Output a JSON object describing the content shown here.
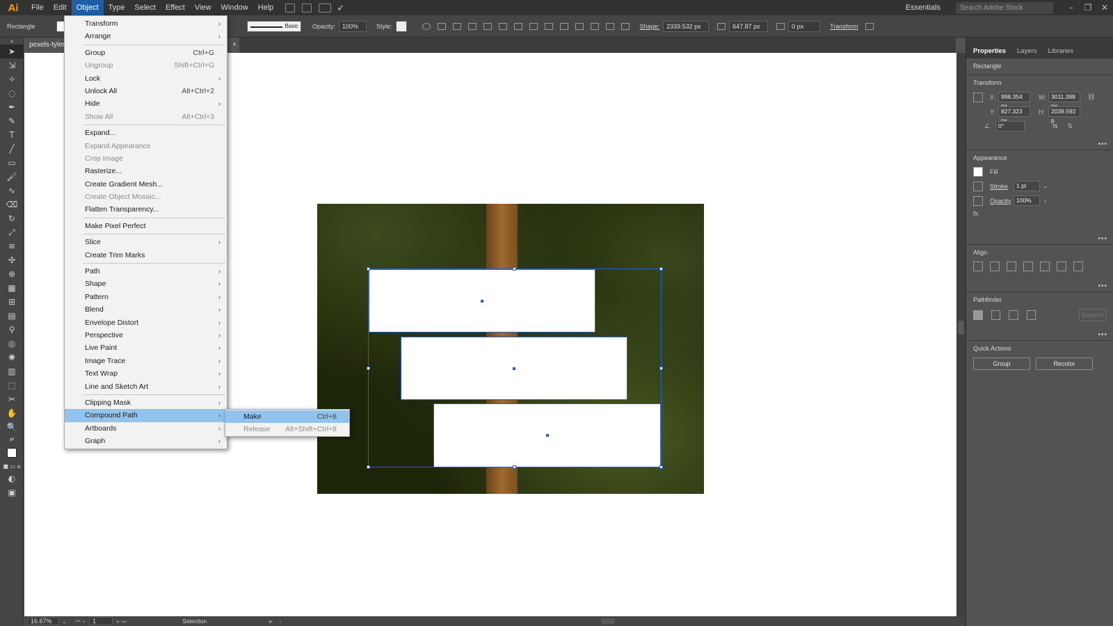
{
  "app": {
    "logo": "Ai"
  },
  "menubar": {
    "items": [
      "File",
      "Edit",
      "Object",
      "Type",
      "Select",
      "Effect",
      "View",
      "Window",
      "Help"
    ],
    "active": "Object",
    "workspace": "Essentials",
    "search_placeholder": "Search Adobe Stock"
  },
  "controlbar": {
    "object_type": "Rectangle",
    "stroke_style": "Basic",
    "opacity_label": "Opacity:",
    "opacity_value": "100%",
    "style_label": "Style:",
    "shape_label": "Shape:",
    "shape_width": "2339.532 px",
    "shape_height": "647.87 px",
    "corner_radius": "0 px",
    "transform_label": "Transform"
  },
  "document": {
    "tab_title": "pexels-tyler",
    "close": "×"
  },
  "object_menu": {
    "rows": [
      {
        "label": "Transform",
        "arrow": true
      },
      {
        "label": "Arrange",
        "arrow": true
      },
      {
        "sep": true
      },
      {
        "label": "Group",
        "shortcut": "Ctrl+G"
      },
      {
        "label": "Ungroup",
        "shortcut": "Shift+Ctrl+G",
        "disabled": true
      },
      {
        "label": "Lock",
        "arrow": true
      },
      {
        "label": "Unlock All",
        "shortcut": "Alt+Ctrl+2"
      },
      {
        "label": "Hide",
        "arrow": true
      },
      {
        "label": "Show All",
        "shortcut": "Alt+Ctrl+3",
        "disabled": true
      },
      {
        "sep": true
      },
      {
        "label": "Expand..."
      },
      {
        "label": "Expand Appearance",
        "disabled": true
      },
      {
        "label": "Crop Image",
        "disabled": true
      },
      {
        "label": "Rasterize..."
      },
      {
        "label": "Create Gradient Mesh..."
      },
      {
        "label": "Create Object Mosaic...",
        "disabled": true
      },
      {
        "label": "Flatten Transparency..."
      },
      {
        "sep": true
      },
      {
        "label": "Make Pixel Perfect"
      },
      {
        "sep": true
      },
      {
        "label": "Slice",
        "arrow": true
      },
      {
        "label": "Create Trim Marks"
      },
      {
        "sep": true
      },
      {
        "label": "Path",
        "arrow": true
      },
      {
        "label": "Shape",
        "arrow": true
      },
      {
        "label": "Pattern",
        "arrow": true
      },
      {
        "label": "Blend",
        "arrow": true
      },
      {
        "label": "Envelope Distort",
        "arrow": true
      },
      {
        "label": "Perspective",
        "arrow": true
      },
      {
        "label": "Live Paint",
        "arrow": true
      },
      {
        "label": "Image Trace",
        "arrow": true
      },
      {
        "label": "Text Wrap",
        "arrow": true
      },
      {
        "label": "Line and Sketch Art",
        "arrow": true
      },
      {
        "sep": true
      },
      {
        "label": "Clipping Mask",
        "arrow": true
      },
      {
        "label": "Compound Path",
        "arrow": true,
        "highlight": true
      },
      {
        "label": "Artboards",
        "arrow": true
      },
      {
        "label": "Graph",
        "arrow": true
      }
    ]
  },
  "compound_submenu": {
    "rows": [
      {
        "label": "Make",
        "shortcut": "Ctrl+8",
        "highlight": true
      },
      {
        "label": "Release",
        "shortcut": "Alt+Shift+Ctrl+8",
        "disabled": true
      }
    ]
  },
  "panel": {
    "tabs": [
      "Properties",
      "Layers",
      "Libraries"
    ],
    "active_tab": "Properties",
    "object_type": "Rectangle",
    "transform": {
      "title": "Transform",
      "x_label": "X:",
      "x": "998.354 px",
      "y_label": "Y:",
      "y": "827.323 px",
      "w_label": "W:",
      "w": "3011.398 px",
      "h_label": "H:",
      "h": "2039.592 p",
      "angle": "0°"
    },
    "appearance": {
      "title": "Appearance",
      "fill_label": "Fill",
      "stroke_label": "Stroke",
      "stroke_weight": "1 pt",
      "opacity_label": "Opacity",
      "opacity": "100%",
      "fx": "fx."
    },
    "align": {
      "title": "Align"
    },
    "pathfinder": {
      "title": "Pathfinder",
      "expand": "Expand"
    },
    "quick_actions": {
      "title": "Quick Actions",
      "group": "Group",
      "recolor": "Recolor"
    }
  },
  "statusbar": {
    "zoom": "16.67%",
    "artboard": "1",
    "tool": "Selection"
  },
  "colors": {
    "menu_highlight": "#91c3ee",
    "selection": "#1f5fe0",
    "logo": "#ff9a00"
  }
}
